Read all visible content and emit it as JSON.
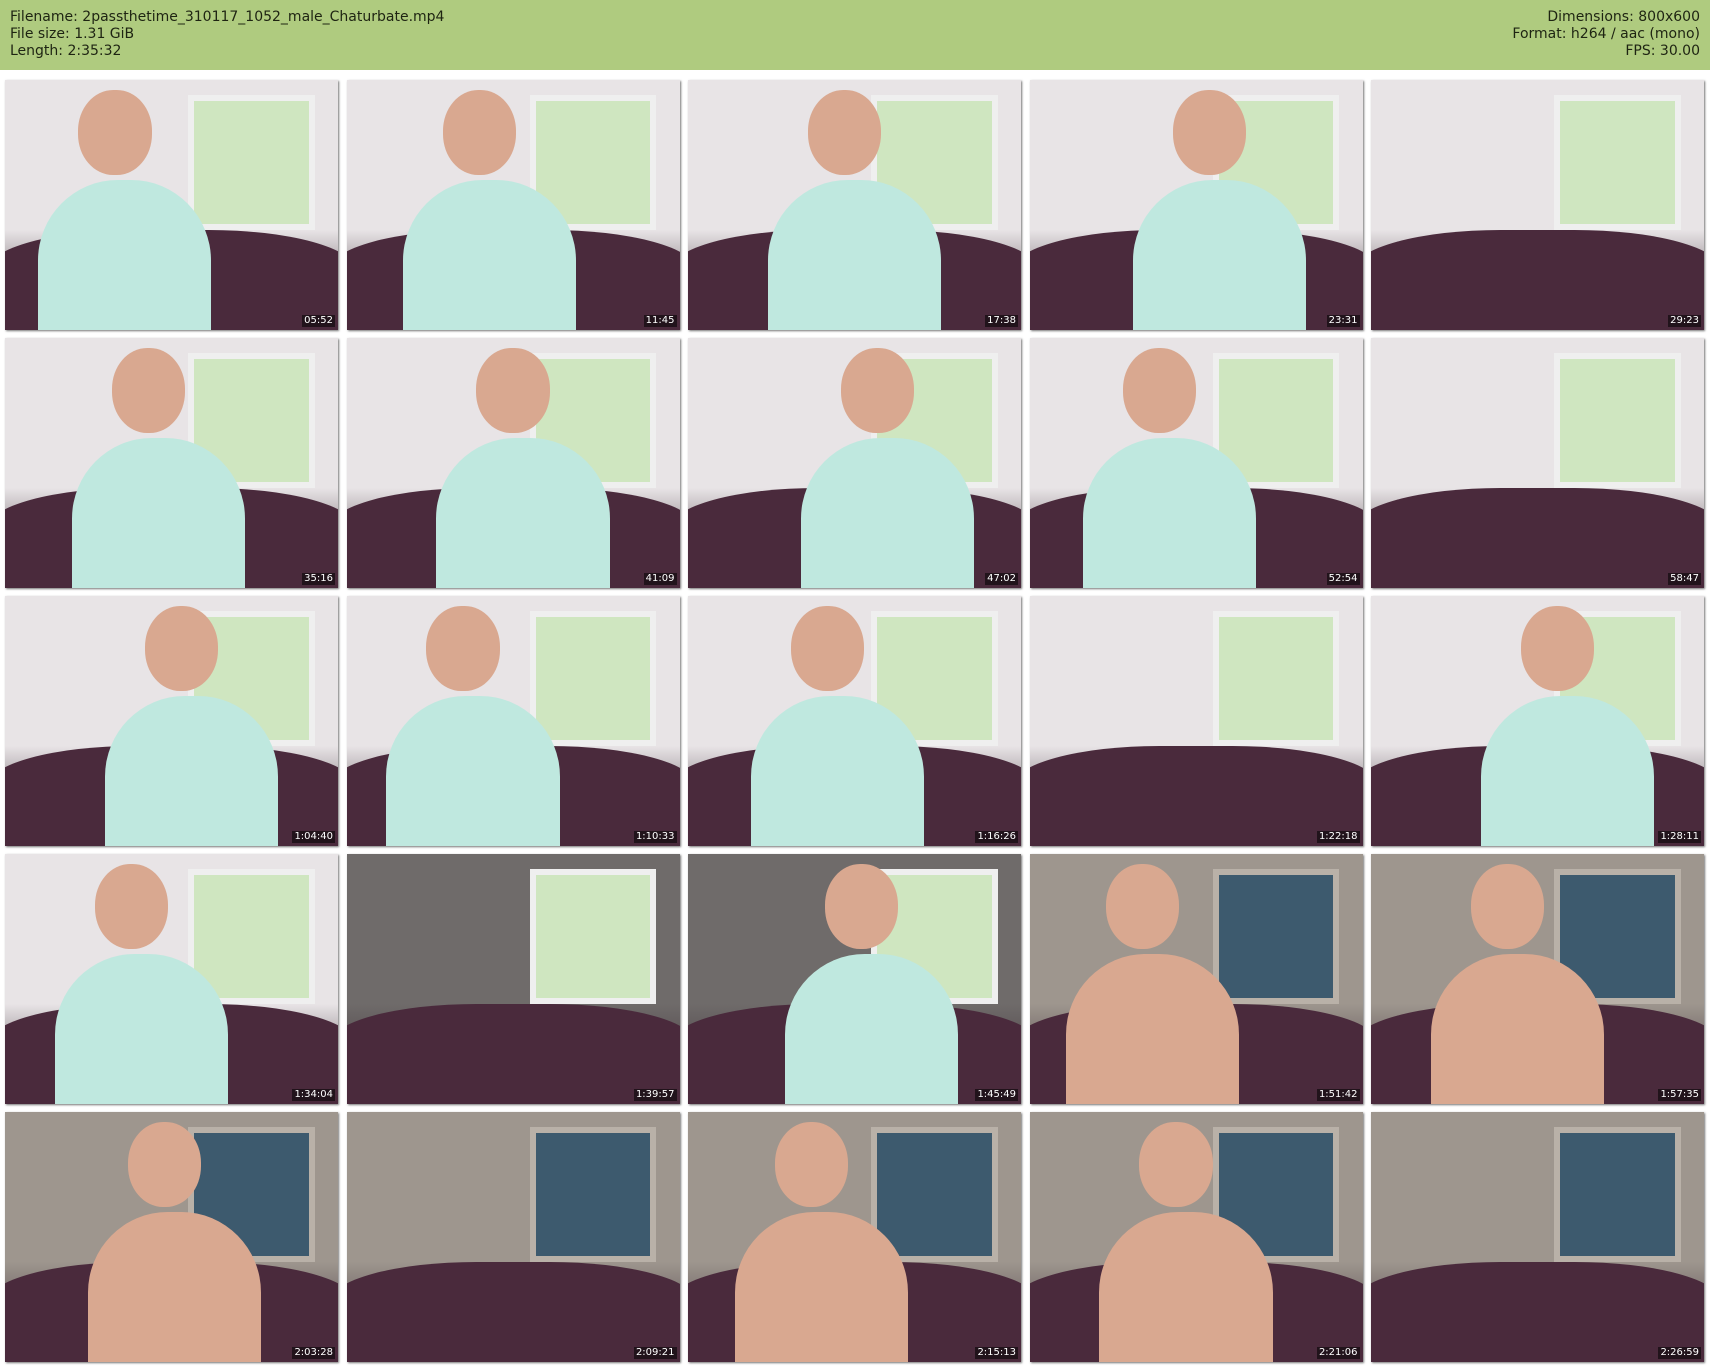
{
  "header": {
    "left": [
      "Filename: 2passthetime_310117_1052_male_Chaturbate.mp4",
      "File size: 1.31 GiB",
      "Length: 2:35:32"
    ],
    "right": [
      "Dimensions: 800x600",
      "Format: h264 / aac (mono)",
      "FPS: 30.00"
    ]
  },
  "colors": {
    "header_bg": "#afcb7f",
    "wall_day": "#e8e4e6",
    "wall_night": "#9e968e",
    "sofa": "#4a2a3c",
    "shirt": "#bfe8df",
    "skin": "#d9a890",
    "window_day": "#cfe6c0",
    "window_night": "#3d5a6e"
  },
  "thumbnails": [
    {
      "time": "05:52",
      "scene": "day",
      "person": "shirt"
    },
    {
      "time": "11:45",
      "scene": "day",
      "person": "shirt"
    },
    {
      "time": "17:38",
      "scene": "day",
      "person": "shirt"
    },
    {
      "time": "23:31",
      "scene": "day",
      "person": "shirt"
    },
    {
      "time": "29:23",
      "scene": "day",
      "person": "none"
    },
    {
      "time": "35:16",
      "scene": "day",
      "person": "shirt"
    },
    {
      "time": "41:09",
      "scene": "day",
      "person": "shirt"
    },
    {
      "time": "47:02",
      "scene": "day",
      "person": "shirt"
    },
    {
      "time": "52:54",
      "scene": "day",
      "person": "shirt"
    },
    {
      "time": "58:47",
      "scene": "day",
      "person": "none"
    },
    {
      "time": "1:04:40",
      "scene": "day",
      "person": "shirt"
    },
    {
      "time": "1:10:33",
      "scene": "day",
      "person": "shirt"
    },
    {
      "time": "1:16:26",
      "scene": "day",
      "person": "shirt"
    },
    {
      "time": "1:22:18",
      "scene": "day",
      "person": "none"
    },
    {
      "time": "1:28:11",
      "scene": "day",
      "person": "shirt"
    },
    {
      "time": "1:34:04",
      "scene": "day",
      "person": "shirt"
    },
    {
      "time": "1:39:57",
      "scene": "dusk",
      "person": "none"
    },
    {
      "time": "1:45:49",
      "scene": "dusk",
      "person": "shirt"
    },
    {
      "time": "1:51:42",
      "scene": "night",
      "person": "bare"
    },
    {
      "time": "1:57:35",
      "scene": "night",
      "person": "bare"
    },
    {
      "time": "2:03:28",
      "scene": "night",
      "person": "bare"
    },
    {
      "time": "2:09:21",
      "scene": "night",
      "person": "none"
    },
    {
      "time": "2:15:13",
      "scene": "night",
      "person": "bare"
    },
    {
      "time": "2:21:06",
      "scene": "night",
      "person": "bare"
    },
    {
      "time": "2:26:59",
      "scene": "night",
      "person": "none"
    }
  ]
}
